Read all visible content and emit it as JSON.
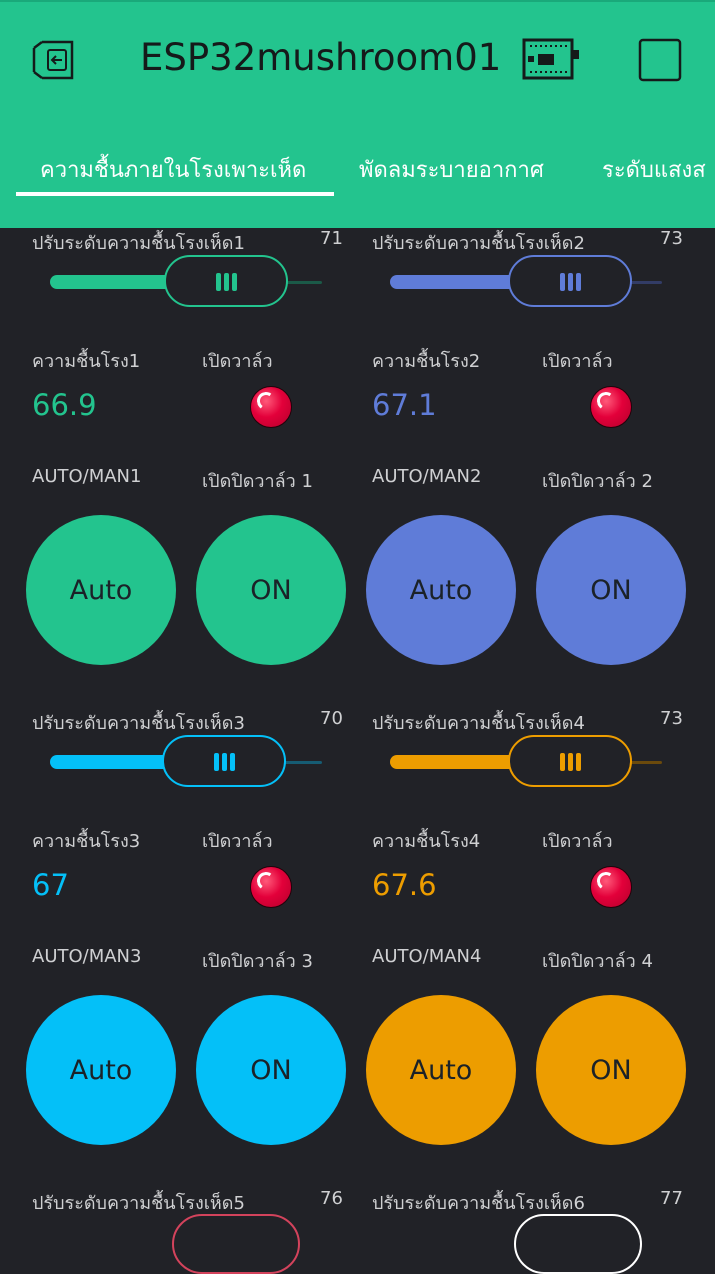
{
  "app": {
    "title": "ESP32mushroom01"
  },
  "icons": {
    "back": "exit-icon",
    "device": "board-icon",
    "menu": "square-icon"
  },
  "tabs": [
    {
      "label": "ความชื้นภายในโรงเพาะเห็ด",
      "active": true
    },
    {
      "label": "พัดลมระบายอากาศ",
      "active": false
    },
    {
      "label": "ระดับแสงส",
      "active": false
    }
  ],
  "colors": {
    "green": "#23c48e",
    "blue": "#5f7cd8",
    "cyan": "#04c0f8",
    "orange": "#ed9d00",
    "red": "#d3435c",
    "white": "#ffffff",
    "header": "#23c48e"
  },
  "sliders": [
    {
      "label": "ปรับระดับความชื้นโรงเห็ด1",
      "value": "71",
      "color": "green"
    },
    {
      "label": "ปรับระดับความชื้นโรงเห็ด2",
      "value": "73",
      "color": "blue"
    },
    {
      "label": "ปรับระดับความชื้นโรงเห็ด3",
      "value": "70",
      "color": "cyan"
    },
    {
      "label": "ปรับระดับความชื้นโรงเห็ด4",
      "value": "73",
      "color": "orange"
    },
    {
      "label": "ปรับระดับความชื้นโรงเห็ด5",
      "value": "76",
      "color": "red"
    },
    {
      "label": "ปรับระดับความชื้นโรงเห็ด6",
      "value": "77",
      "color": "white"
    }
  ],
  "displays": [
    {
      "label": "ความชื้นโรง1",
      "value": "66.9"
    },
    {
      "label": "ความชื้นโรง2",
      "value": "67.1"
    },
    {
      "label": "ความชื้นโรง3",
      "value": "67"
    },
    {
      "label": "ความชื้นโรง4",
      "value": "67.6"
    }
  ],
  "leds": [
    {
      "label": "เปิดวาล์ว"
    },
    {
      "label": "เปิดวาล์ว"
    },
    {
      "label": "เปิดวาล์ว"
    },
    {
      "label": "เปิดวาล์ว"
    }
  ],
  "modes": [
    {
      "label": "AUTO/MAN1",
      "button": "Auto"
    },
    {
      "label": "AUTO/MAN2",
      "button": "Auto"
    },
    {
      "label": "AUTO/MAN3",
      "button": "Auto"
    },
    {
      "label": "AUTO/MAN4",
      "button": "Auto"
    }
  ],
  "valves": [
    {
      "label": "เปิดปิดวาล์ว 1",
      "button": "ON"
    },
    {
      "label": "เปิดปิดวาล์ว 2",
      "button": "ON"
    },
    {
      "label": "เปิดปิดวาล์ว 3",
      "button": "ON"
    },
    {
      "label": "เปิดปิดวาล์ว 4",
      "button": "ON"
    }
  ]
}
